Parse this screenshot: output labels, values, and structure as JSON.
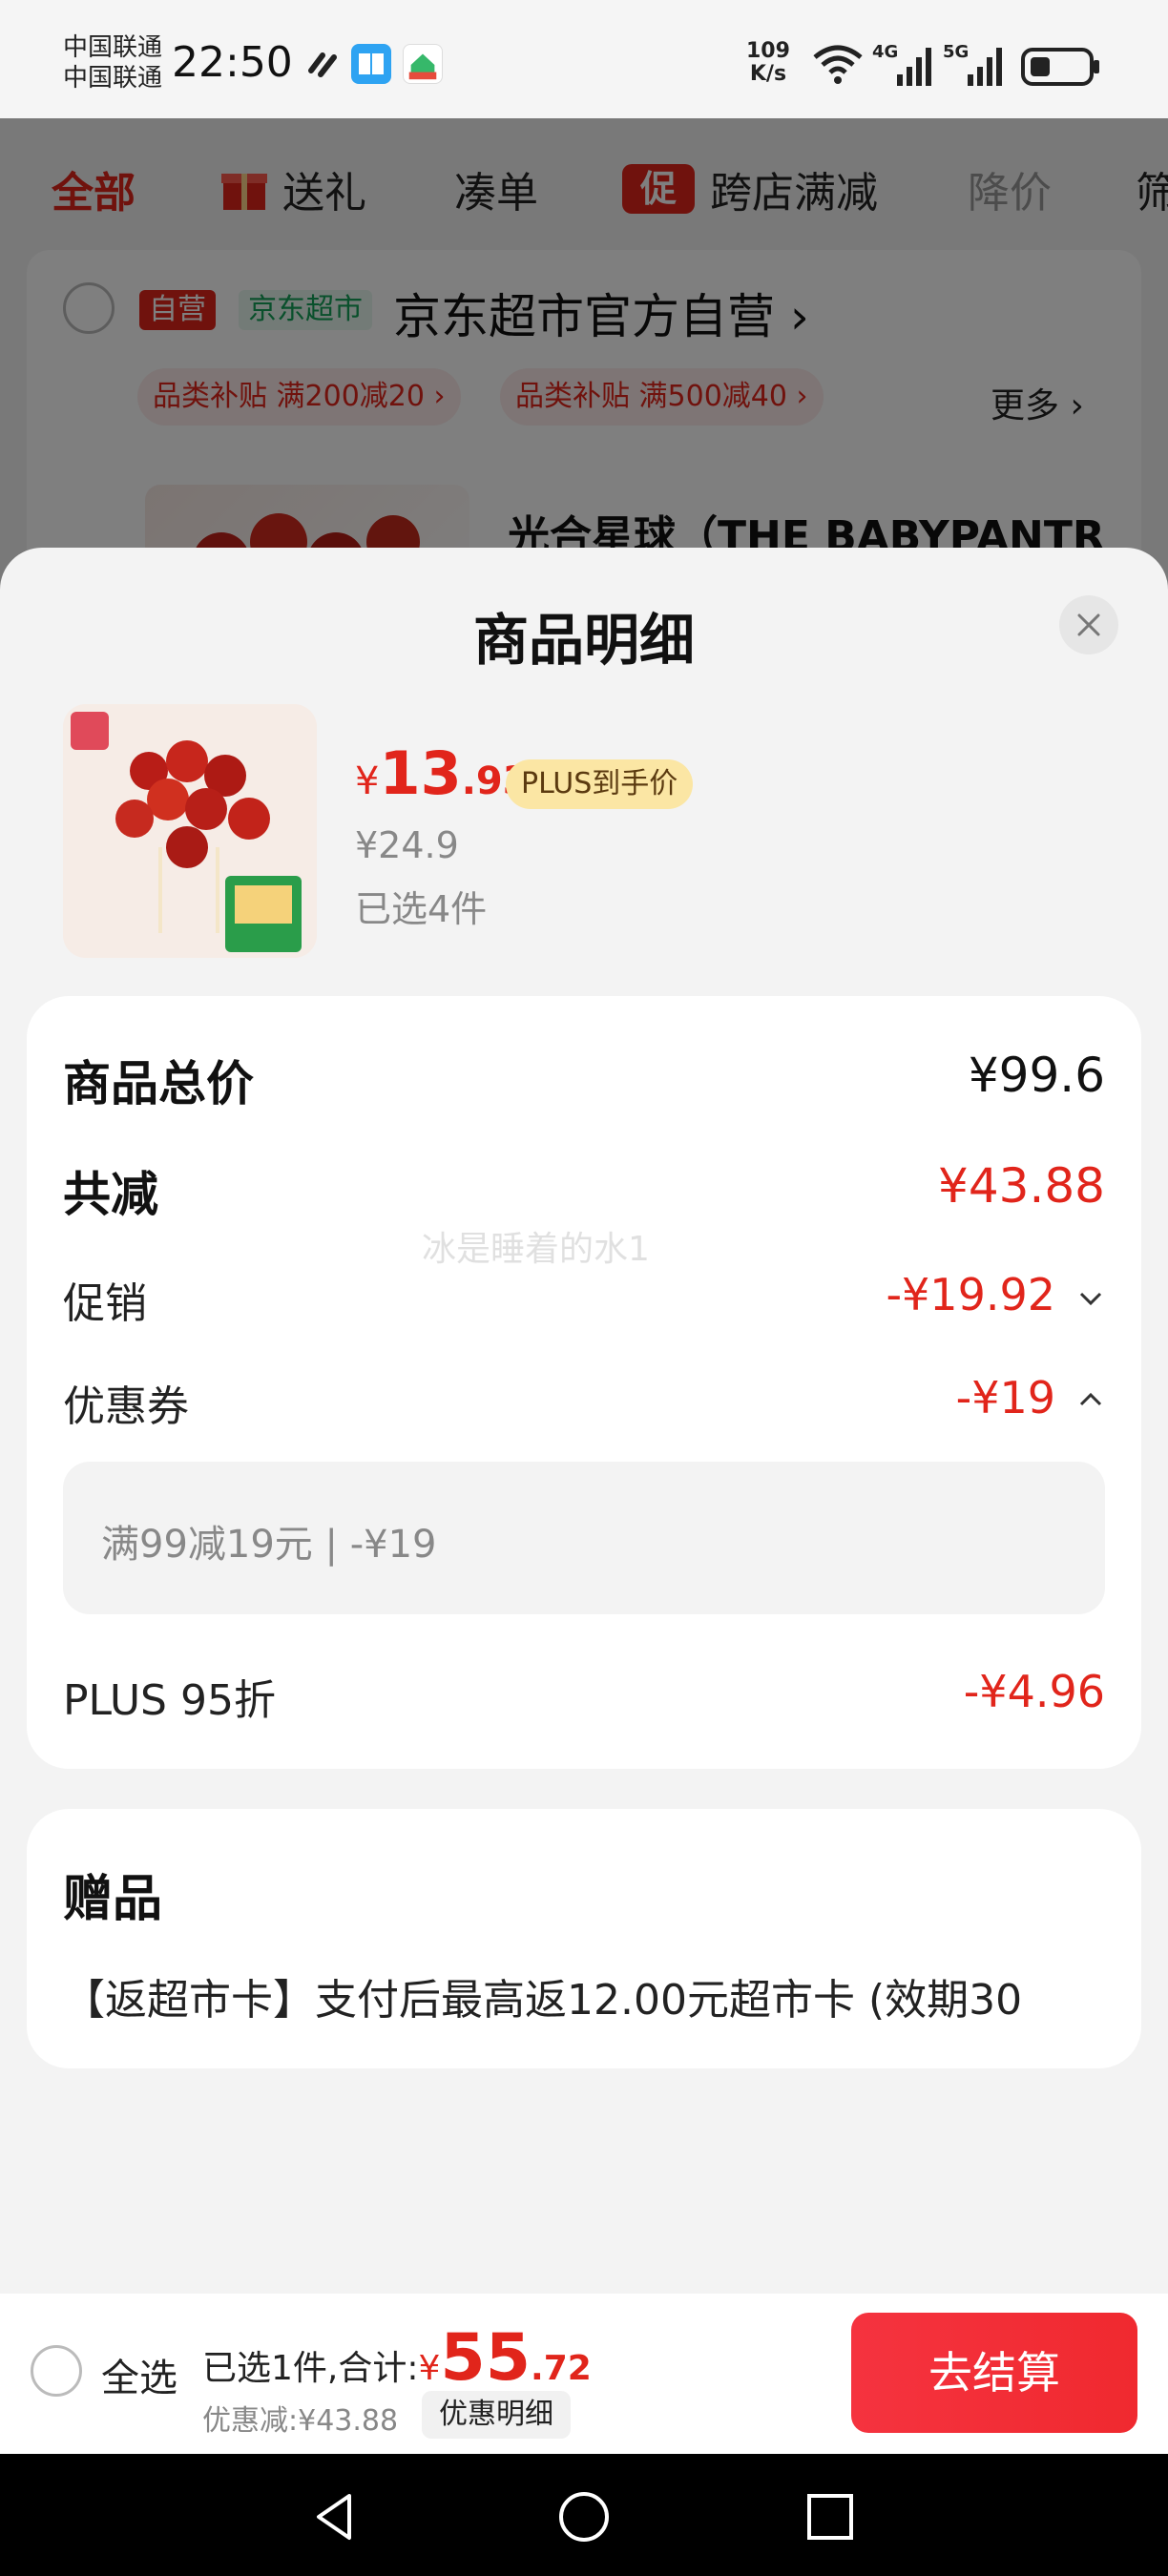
{
  "status_bar": {
    "carrier1": "中国联通",
    "carrier2": "中国联通",
    "time": "22:50",
    "net_speed_value": "109",
    "net_speed_unit": "K/s",
    "net1": "4G",
    "net2": "5G"
  },
  "background_page": {
    "tabs": [
      "全部",
      "送礼",
      "凑单",
      "跨店满减",
      "降价",
      "筛"
    ],
    "promo_icon": "促",
    "store": {
      "tag_self": "自营",
      "tag_jd": "京东超市",
      "name": "京东超市官方自营",
      "promos": [
        "品类补贴 满200减20",
        "品类补贴 满500减40"
      ],
      "more": "更多",
      "product_title": "光合星球（THE BABYPANTR"
    }
  },
  "sheet": {
    "title": "商品明细",
    "product": {
      "currency": "¥",
      "price_int": "13",
      "price_dec": ".93",
      "plus_badge": "PLUS到手价",
      "original_price": "¥24.9",
      "selected": "已选4件"
    },
    "detail": {
      "total_label": "商品总价",
      "total_value": "¥99.6",
      "reduce_label": "共减",
      "reduce_value": "¥43.88",
      "promo_label": "促销",
      "promo_value": "-¥19.92",
      "coupon_label": "优惠券",
      "coupon_value": "-¥19",
      "coupon_detail": "满99减19元 | -¥19",
      "plus_label": "PLUS 95折",
      "plus_value": "-¥4.96",
      "watermark": "冰是睡着的水1"
    },
    "gift": {
      "title": "赠品",
      "text": "【返超市卡】支付后最高返12.00元超市卡 (效期30"
    }
  },
  "bottom_bar": {
    "select_all": "全选",
    "summary_label": "已选1件,合计:",
    "currency": "¥",
    "total_int": "55",
    "total_dec": ".72",
    "discount": "优惠减:¥43.88",
    "detail_button": "优惠明细",
    "checkout": "去结算"
  },
  "colors": {
    "accent_red": "#e1251b",
    "checkout_red": "#f5333f",
    "plus_gold": "#fbe6a4"
  }
}
